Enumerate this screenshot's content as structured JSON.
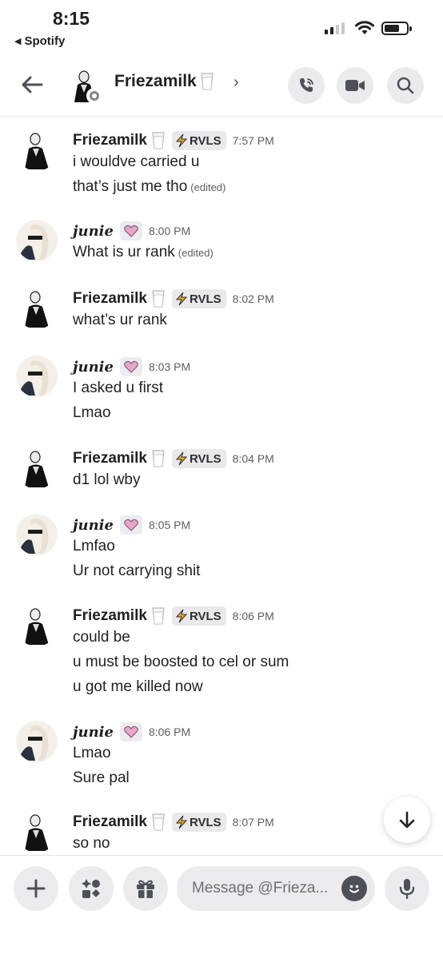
{
  "status_bar": {
    "time": "8:15",
    "back_app": "Spotify",
    "signal_bars": 2,
    "icons": [
      "cellular-icon",
      "wifi-icon",
      "battery-icon"
    ]
  },
  "header": {
    "name": "Friezamilk",
    "name_emoji": "🥛",
    "chevron": "›",
    "icons": [
      "back-arrow-icon",
      "phone-call-icon",
      "video-call-icon",
      "search-icon"
    ]
  },
  "messages": [
    {
      "author": "Friezamilk",
      "milk": "🥛",
      "tag": "RVLS",
      "time": "7:57 PM",
      "lines": [
        {
          "text": "i wouldve carried u",
          "edited": ""
        },
        {
          "text": "that’s just me tho",
          "edited": "(edited)"
        }
      ]
    },
    {
      "author": "junie",
      "heart": true,
      "time": "8:00 PM",
      "lines": [
        {
          "text": "What is ur rank",
          "edited": "(edited)"
        }
      ]
    },
    {
      "author": "Friezamilk",
      "milk": "🥛",
      "tag": "RVLS",
      "time": "8:02 PM",
      "lines": [
        {
          "text": "what’s ur rank",
          "edited": ""
        }
      ]
    },
    {
      "author": "junie",
      "heart": true,
      "time": "8:03 PM",
      "lines": [
        {
          "text": "I asked u first",
          "edited": ""
        },
        {
          "text": "Lmao",
          "edited": ""
        }
      ]
    },
    {
      "author": "Friezamilk",
      "milk": "🥛",
      "tag": "RVLS",
      "time": "8:04 PM",
      "lines": [
        {
          "text": "d1 lol wby",
          "edited": ""
        }
      ]
    },
    {
      "author": "junie",
      "heart": true,
      "time": "8:05 PM",
      "lines": [
        {
          "text": "Lmfao",
          "edited": ""
        },
        {
          "text": "Ur not carrying shit",
          "edited": ""
        }
      ]
    },
    {
      "author": "Friezamilk",
      "milk": "🥛",
      "tag": "RVLS",
      "time": "8:06 PM",
      "lines": [
        {
          "text": "could be",
          "edited": ""
        },
        {
          "text": "u must be boosted to cel or sum",
          "edited": ""
        },
        {
          "text": "u got me killed now",
          "edited": ""
        }
      ]
    },
    {
      "author": "junie",
      "heart": true,
      "time": "8:06 PM",
      "lines": [
        {
          "text": "Lmao",
          "edited": ""
        },
        {
          "text": "Sure pal",
          "edited": ""
        }
      ]
    },
    {
      "author": "Friezamilk",
      "milk": "🥛",
      "tag": "RVLS",
      "time": "8:07 PM",
      "lines": [
        {
          "text": "so no",
          "edited": ""
        }
      ]
    }
  ],
  "composer": {
    "placeholder": "Message @Frieza...",
    "icons": [
      "plus-icon",
      "apps-icon",
      "gift-icon",
      "emoji-icon",
      "microphone-icon"
    ]
  },
  "fab": {
    "icon": "arrow-down-icon"
  },
  "colors": {
    "button_bg": "#ebebed",
    "text": "#1f2023",
    "muted": "#5c5e66",
    "bolt": "#f0a81c",
    "heart": "#e7a7c8"
  }
}
